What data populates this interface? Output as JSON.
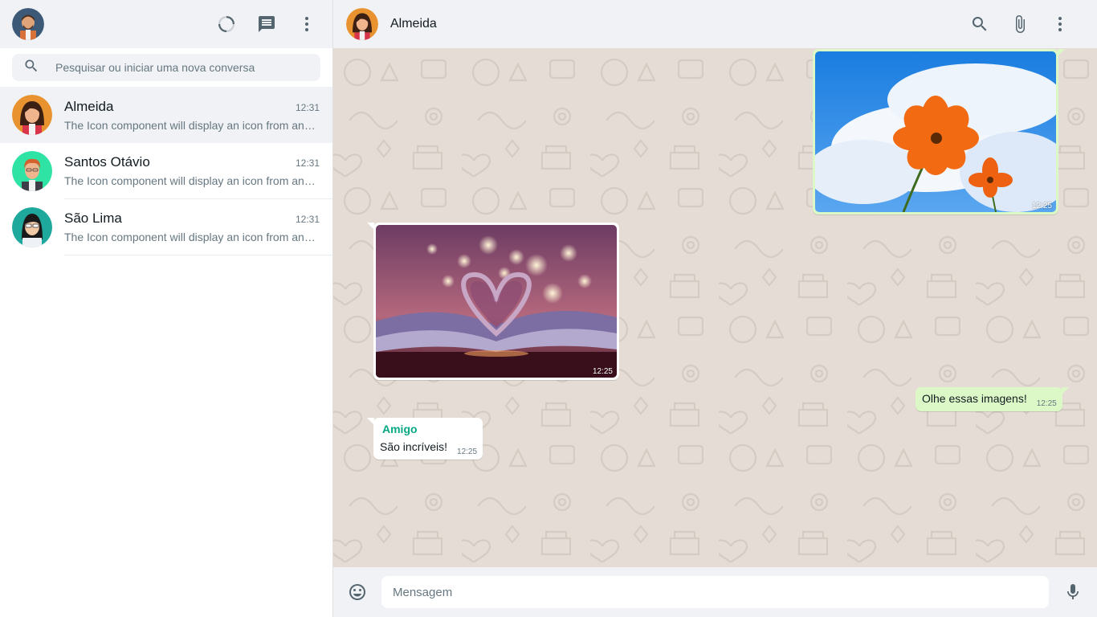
{
  "sidebar": {
    "search": {
      "placeholder": "Pesquisar ou iniciar uma nova conversa"
    },
    "chats": [
      {
        "name": "Almeida",
        "time": "12:31",
        "preview": "The Icon component will display an icon from any font that is supported by this library",
        "active": true,
        "avatar": "woman-avatar-orange"
      },
      {
        "name": "Santos Otávio",
        "time": "12:31",
        "preview": "The Icon component will display an icon from any font that is supported by this library",
        "active": false,
        "avatar": "man-avatar-green"
      },
      {
        "name": "São Lima",
        "time": "12:31",
        "preview": "The Icon component will display an icon from any font that is supported by this library",
        "active": false,
        "avatar": "woman-avatar-teal"
      }
    ],
    "icons": [
      "status-icon",
      "new-chat-icon",
      "menu-icon"
    ]
  },
  "main": {
    "header": {
      "title": "Almeida"
    },
    "icons": [
      "search-icon",
      "attach-icon",
      "menu-icon"
    ],
    "messages": [
      {
        "type": "image",
        "direction": "out",
        "image": "orange-flowers-sky",
        "time": "12:25"
      },
      {
        "type": "image",
        "direction": "in",
        "image": "heart-book-bokeh",
        "time": "12:25"
      },
      {
        "type": "text",
        "direction": "out",
        "text": "Olhe essas imagens!",
        "time": "12:25"
      },
      {
        "type": "text",
        "direction": "in",
        "sender": "Amigo",
        "text": "São incríveis!",
        "time": "12:25"
      }
    ]
  },
  "footer": {
    "placeholder": "Mensagem",
    "icons": [
      "emoji-icon",
      "microphone-icon"
    ]
  },
  "colors": {
    "outgoing_bubble": "#dcf8c6",
    "chat_background": "#e5ddd5",
    "header_bg": "#f0f2f5",
    "sender_name": "#06a884"
  }
}
